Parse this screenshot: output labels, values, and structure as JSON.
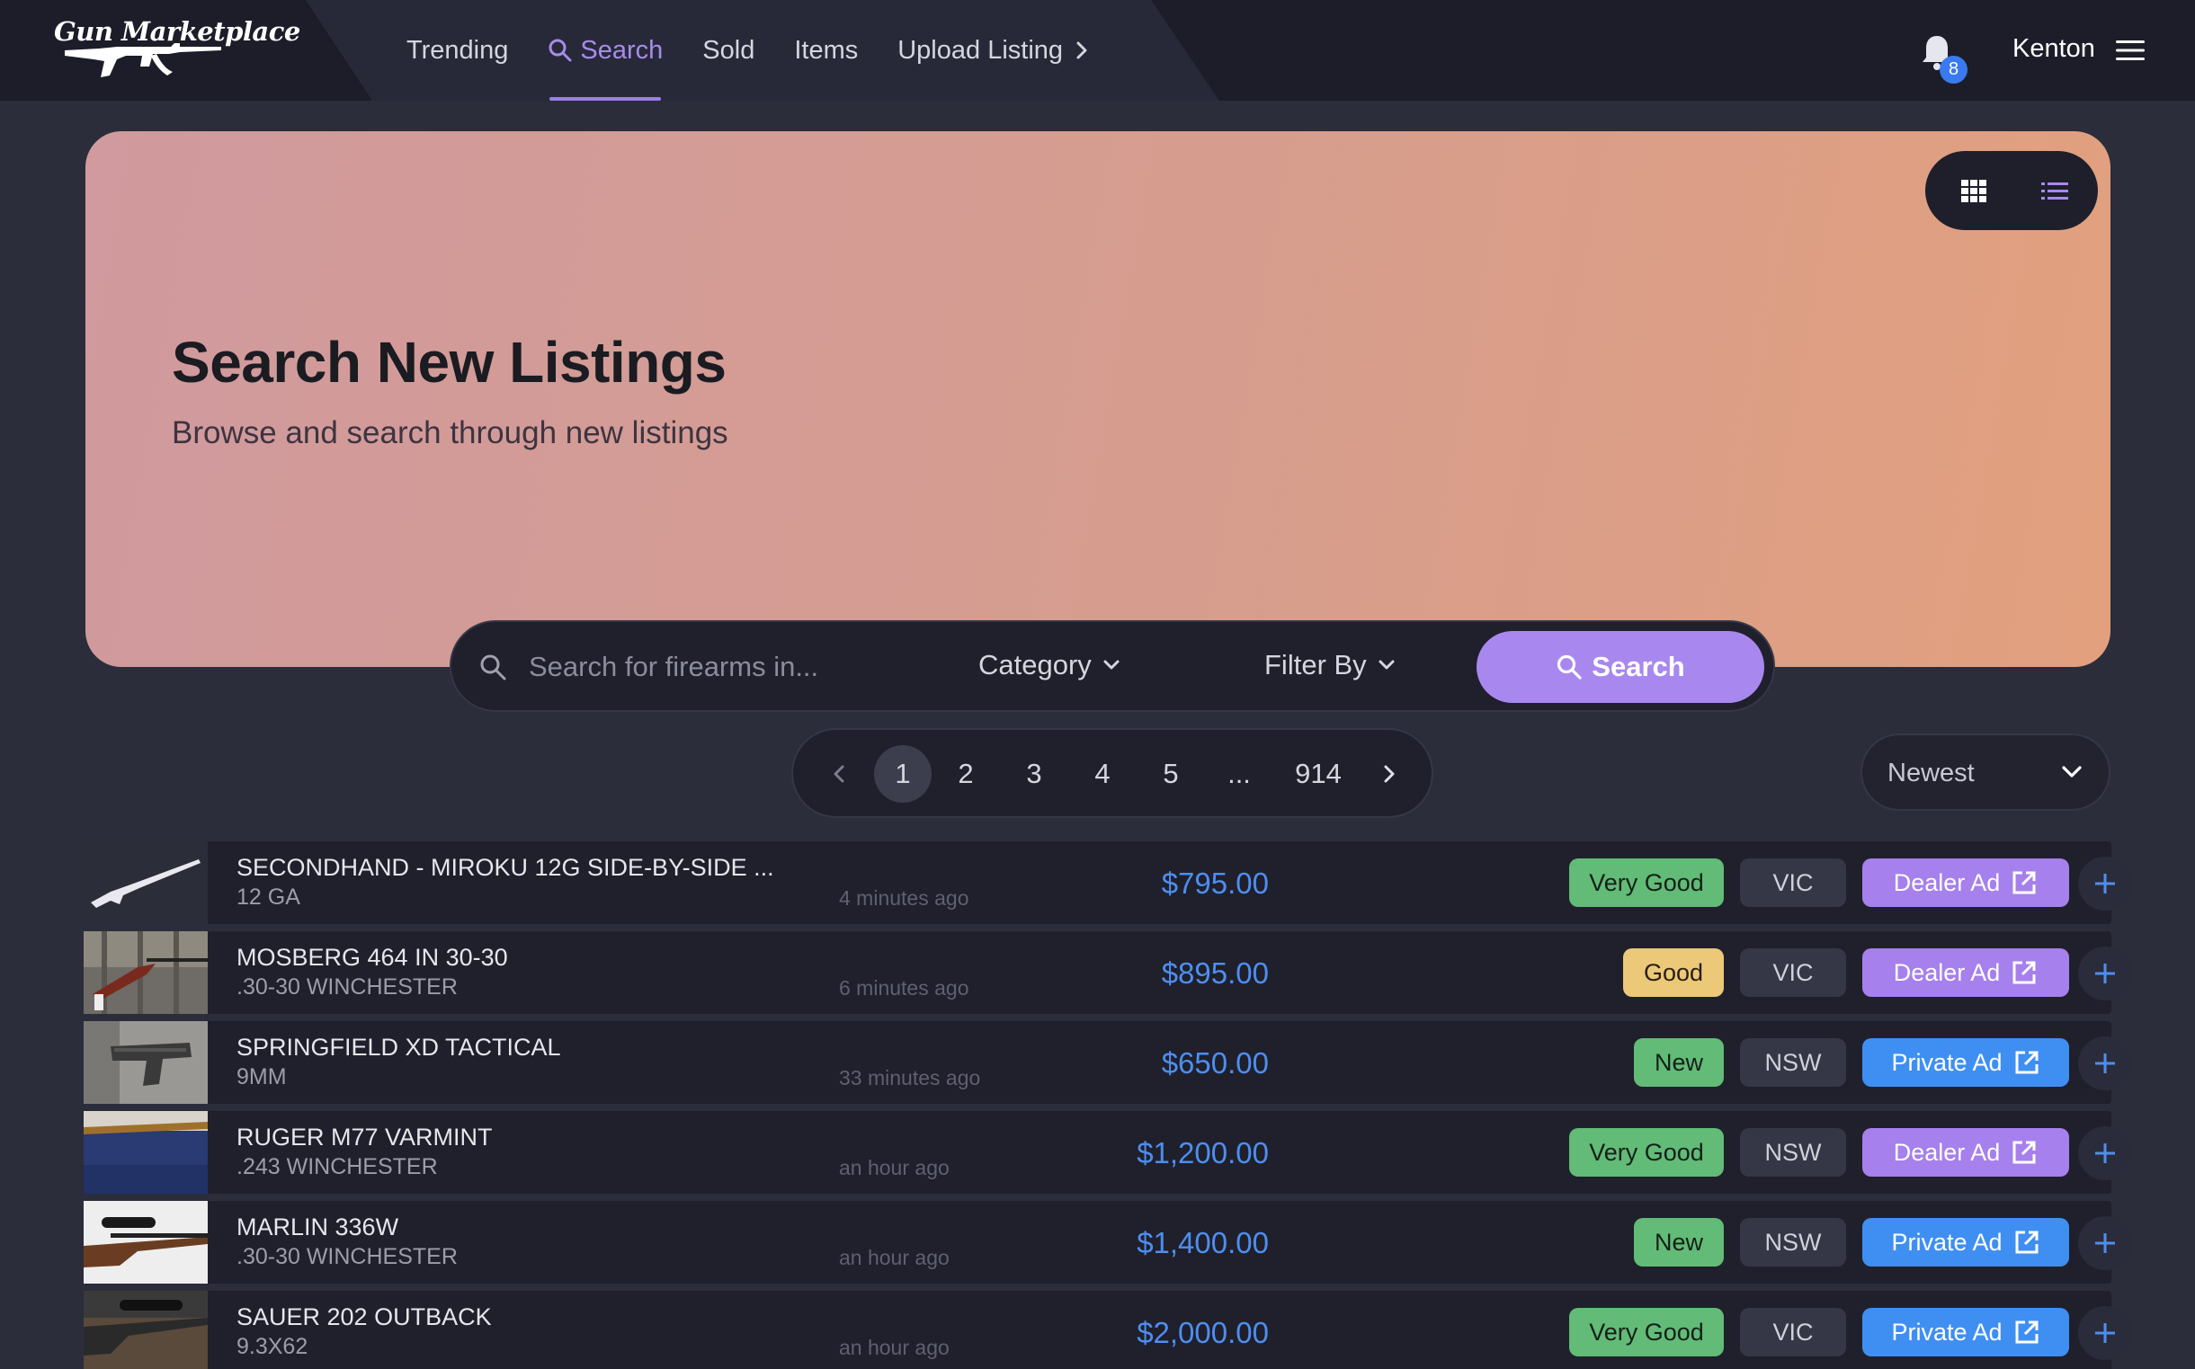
{
  "brand": {
    "name": "Gun Marketplace"
  },
  "nav": {
    "items": [
      {
        "label": "Trending"
      },
      {
        "label": "Search"
      },
      {
        "label": "Sold"
      },
      {
        "label": "Items"
      },
      {
        "label": "Upload Listing"
      }
    ],
    "active": "Search"
  },
  "notifications": {
    "count": "8"
  },
  "user": {
    "name": "Kenton"
  },
  "hero": {
    "title": "Search New Listings",
    "subtitle": "Browse and search through new listings"
  },
  "search": {
    "placeholder": "Search for firearms in...",
    "category_label": "Category",
    "filter_label": "Filter By",
    "button_label": "Search"
  },
  "pagination": {
    "pages": [
      "1",
      "2",
      "3",
      "4",
      "5",
      "...",
      "914"
    ],
    "current": "1"
  },
  "sort": {
    "selected": "Newest"
  },
  "colors": {
    "accent": "#a888ee",
    "price": "#4e8ef0",
    "dealer": "#a680ec",
    "private": "#3f8ff2",
    "very_good": "#62bb77",
    "good": "#ecc978"
  },
  "listings": [
    {
      "name": "SECONDHAND - MIROKU 12G SIDE-BY-SIDE ...",
      "caliber": "12 GA",
      "time": "4 minutes ago",
      "price": "$795.00",
      "condition": "Very Good",
      "state": "VIC",
      "ad_type": "Dealer Ad"
    },
    {
      "name": "MOSBERG 464 IN 30-30",
      "caliber": ".30-30 WINCHESTER",
      "time": "6 minutes ago",
      "price": "$895.00",
      "condition": "Good",
      "state": "VIC",
      "ad_type": "Dealer Ad"
    },
    {
      "name": "SPRINGFIELD XD TACTICAL",
      "caliber": "9MM",
      "time": "33 minutes ago",
      "price": "$650.00",
      "condition": "New",
      "state": "NSW",
      "ad_type": "Private Ad"
    },
    {
      "name": "RUGER M77 VARMINT",
      "caliber": ".243 WINCHESTER",
      "time": "an hour ago",
      "price": "$1,200.00",
      "condition": "Very Good",
      "state": "NSW",
      "ad_type": "Dealer Ad"
    },
    {
      "name": "MARLIN 336W",
      "caliber": ".30-30 WINCHESTER",
      "time": "an hour ago",
      "price": "$1,400.00",
      "condition": "New",
      "state": "NSW",
      "ad_type": "Private Ad"
    },
    {
      "name": "SAUER 202 OUTBACK",
      "caliber": "9.3X62",
      "time": "an hour ago",
      "price": "$2,000.00",
      "condition": "Very Good",
      "state": "VIC",
      "ad_type": "Private Ad"
    }
  ]
}
